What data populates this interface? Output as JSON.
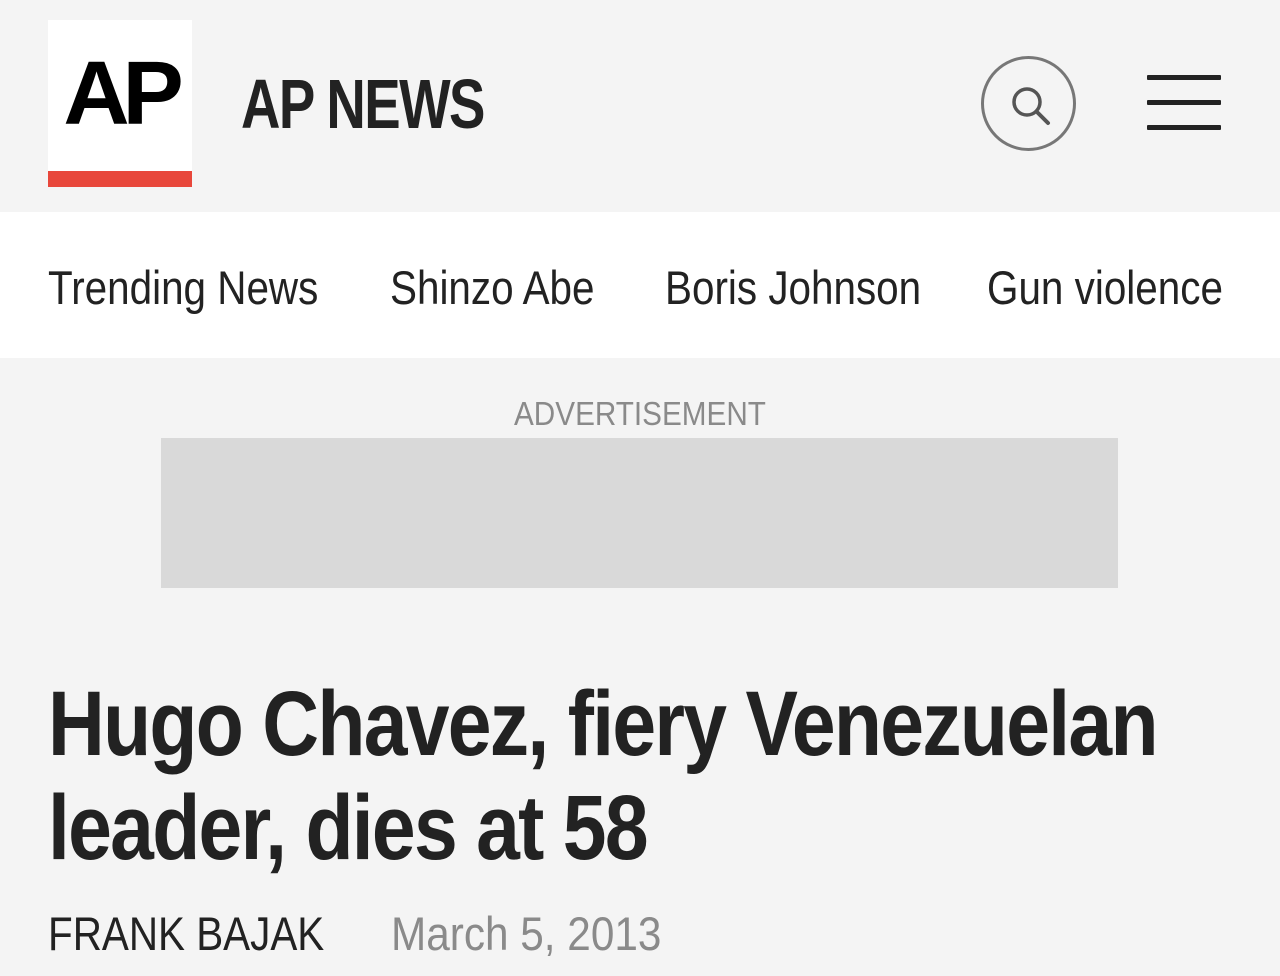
{
  "header": {
    "logo_text": "AP",
    "title": "AP NEWS",
    "search_icon": "search-icon",
    "menu_icon": "hamburger-menu-icon",
    "accent_color": "#e8473b"
  },
  "nav": {
    "items": [
      {
        "label": "Trending News"
      },
      {
        "label": "Shinzo Abe"
      },
      {
        "label": "Boris Johnson"
      },
      {
        "label": "Gun violence"
      }
    ]
  },
  "ad": {
    "label": "ADVERTISEMENT"
  },
  "article": {
    "headline": "Hugo Chavez, fiery Venezuelan leader, dies at 58",
    "author": "FRANK BAJAK",
    "date": "March 5, 2013"
  }
}
